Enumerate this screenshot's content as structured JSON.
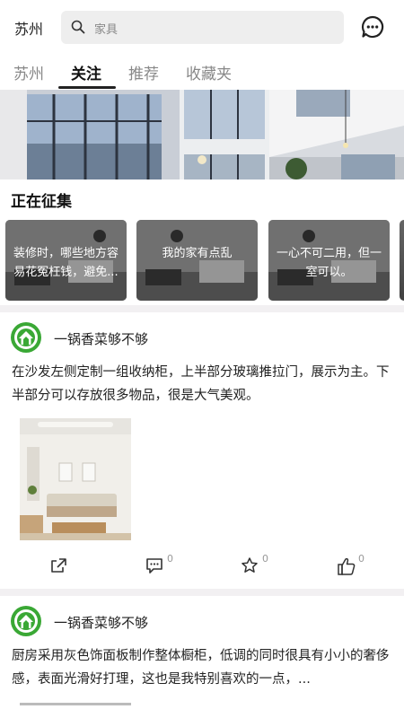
{
  "header": {
    "city": "苏州",
    "search_placeholder": "家具"
  },
  "tabs": [
    {
      "label": "苏州"
    },
    {
      "label": "关注"
    },
    {
      "label": "推荐"
    },
    {
      "label": "收藏夹"
    }
  ],
  "active_tab": "关注",
  "section": {
    "title": "正在征集"
  },
  "cards": [
    {
      "text": "装修时，哪些地方容易花冤枉钱，避免..."
    },
    {
      "text": "我的家有点乱"
    },
    {
      "text": "一心不可二用，但一室可以。"
    }
  ],
  "posts": [
    {
      "author": "一锅香菜够不够",
      "text": "在沙发左侧定制一组收纳柜，上半部分玻璃推拉门，展示为主。下半部分可以存放很多物品，很是大气美观。",
      "comments": "0",
      "stars": "0",
      "likes": "0"
    },
    {
      "author": "一锅香菜够不够",
      "text": "厨房采用灰色饰面板制作整体橱柜，低调的同时很具有小小的奢侈感，表面光滑好打理，这也是我特别喜欢的一点，..."
    }
  ],
  "colors": {
    "avatar_green": "#3aa835",
    "divider": "#f2f0f2",
    "search_bg": "#eeeeee"
  }
}
